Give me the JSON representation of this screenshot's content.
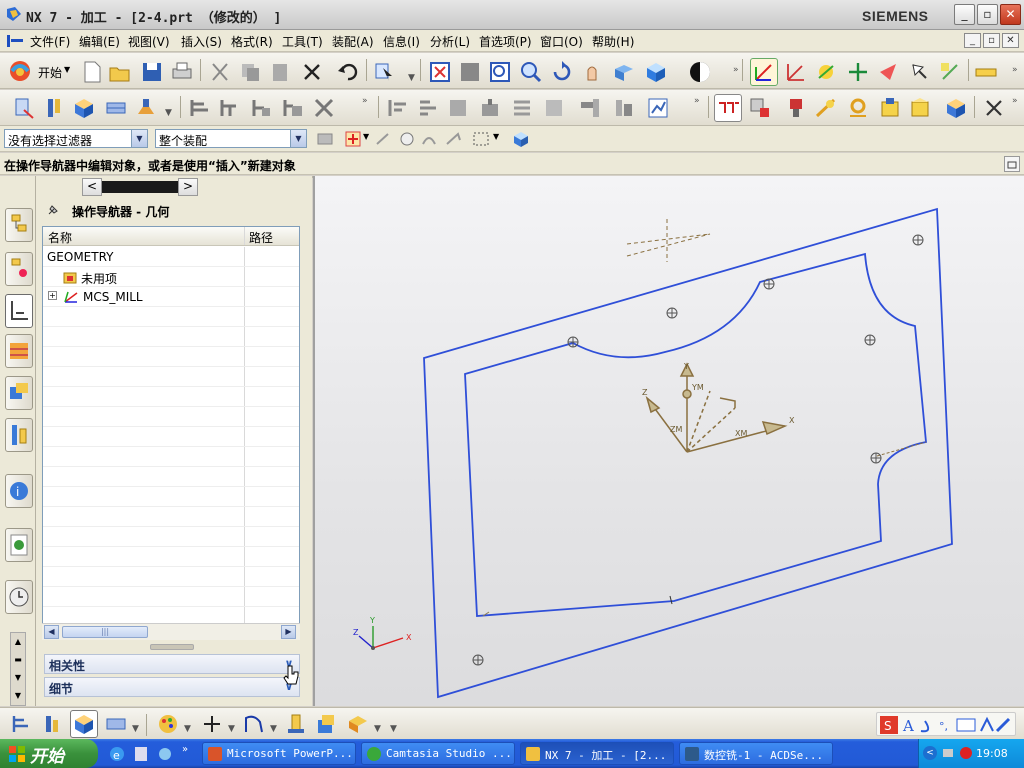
{
  "window": {
    "title": "NX 7 - 加工 - [2-4.prt （修改的） ]",
    "brand": "SIEMENS",
    "min": "_",
    "max": "▫",
    "close": "✕"
  },
  "menu": [
    "文件(F)",
    "编辑(E)",
    "视图(V)",
    "插入(S)",
    "格式(R)",
    "工具(T)",
    "装配(A)",
    "信息(I)",
    "分析(L)",
    "首选项(P)",
    "窗口(O)",
    "帮助(H)"
  ],
  "toolbar": {
    "start_label": "开始"
  },
  "selection": {
    "filter": "没有选择过滤器",
    "scope": "整个装配"
  },
  "cue_line": "在操作导航器中编辑对象，或者是使用“插入”新建对象",
  "navigator": {
    "title": "操作导航器 - 几何",
    "columns": [
      "名称",
      "路径"
    ],
    "rows": [
      "GEOMETRY",
      "未用项",
      "MCS_MILL"
    ],
    "panels": [
      "相关性",
      "细节"
    ]
  },
  "viewport": {
    "axis_labels": {
      "x": "X",
      "y": "Y",
      "z": "Z",
      "xm": "XM",
      "ym": "YM",
      "zm": "ZM"
    }
  },
  "taskbar": {
    "start": "开始",
    "tasks": [
      "Microsoft PowerP...",
      "Camtasia Studio ...",
      "NX 7 - 加工 - [2...",
      "数控铣-1 - ACDSe..."
    ],
    "clock": "19:08"
  },
  "colors": {
    "part_edge": "#2f4fd8",
    "csys": "#8a7040"
  }
}
